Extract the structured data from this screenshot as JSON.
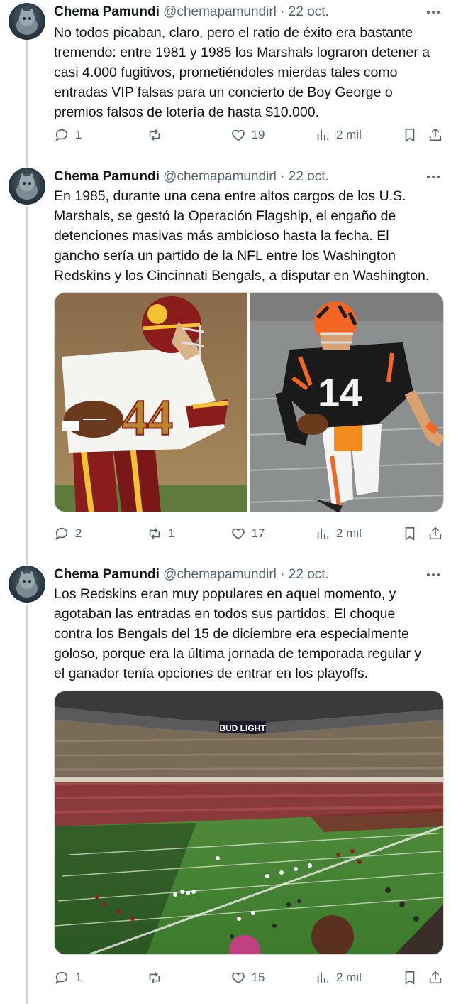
{
  "author": {
    "name": "Chema Pamundi",
    "handle": "@chemapamundirl",
    "separator": "·"
  },
  "tweets": [
    {
      "date": "22 oct.",
      "text": "No todos picaban, claro, pero el ratio de éxito era bastante\ntremendo: entre 1981 y 1985 los Marshals lograron detener a\ncasi 4.000 fugitivos, prometiéndoles mierdas tales como\nentradas VIP falsas para un concierto de Boy George o\npremios falsos de lotería de hasta $10.000.",
      "replies": "1",
      "retweets": "",
      "likes": "19",
      "views": "2 mil"
    },
    {
      "date": "22 oct.",
      "text": "En 1985, durante una cena entre altos cargos de los U.S.\nMarshals, se gestó la Operación Flagship, el engaño de\ndetenciones masivas más ambicioso hasta la fecha. El\ngancho sería un partido de la NFL entre los Washington\nRedskins y los Cincinnati Bengals, a disputar en Washington.",
      "replies": "2",
      "retweets": "1",
      "likes": "17",
      "views": "2 mil"
    },
    {
      "date": "22 oct.",
      "text": "Los Redskins eran muy populares en aquel momento, y\nagotaban las entradas en todos sus partidos. El choque\ncontra los Bengals del 15 de diciembre era especialmente\ngoloso, porque era la última jornada de temporada regular y\nel ganador tenía opciones de entrar en los playoffs.",
      "replies": "1",
      "retweets": "",
      "likes": "15",
      "views": "2 mil"
    }
  ],
  "photos": {
    "redskins_jersey": "44",
    "bengals_jersey": "14",
    "stadium_sign": "BUD LIGHT"
  },
  "icons": {
    "reply": "reply-icon",
    "retweet": "retweet-icon",
    "like": "heart-icon",
    "views": "views-chart-icon",
    "bookmark": "bookmark-icon",
    "share": "share-icon",
    "more": "more-dots-icon"
  },
  "colors": {
    "text": "#0f1419",
    "muted": "#536471",
    "thread": "#cfd9de"
  }
}
